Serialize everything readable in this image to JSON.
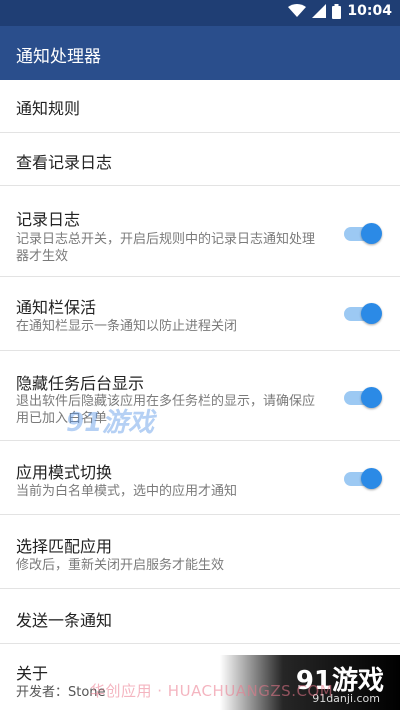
{
  "status_bar": {
    "time": "10:04"
  },
  "app_bar": {
    "title": "通知处理器"
  },
  "rows": [
    {
      "title": "通知规则"
    },
    {
      "title": "查看记录日志"
    },
    {
      "title": "记录日志",
      "subtitle": "记录日志总开关，开启后规则中的记录日志通知处理器才生效",
      "toggle": true
    },
    {
      "title": "通知栏保活",
      "subtitle": "在通知栏显示一条通知以防止进程关闭",
      "toggle": true
    },
    {
      "title": "隐藏任务后台显示",
      "subtitle": "退出软件后隐藏该应用在多任务栏的显示，请确保应用已加入白名单",
      "toggle": true
    },
    {
      "title": "应用模式切换",
      "subtitle": "当前为白名单模式，选中的应用才通知",
      "toggle": true
    },
    {
      "title": "选择匹配应用",
      "subtitle": "修改后，重新关闭开启服务才能生效"
    },
    {
      "title": "发送一条通知"
    },
    {
      "title": "关于",
      "subtitle": "开发者：Stone"
    }
  ],
  "watermarks": {
    "center": "91游戏",
    "url": "华创应用 · HUACHUANGZS.COM",
    "brand": "91游戏",
    "brand_domain": "91danji.com"
  },
  "colors": {
    "status_bar": "#1f3e74",
    "app_bar": "#2a4e8c",
    "toggle_on": "#2b8ae6"
  }
}
